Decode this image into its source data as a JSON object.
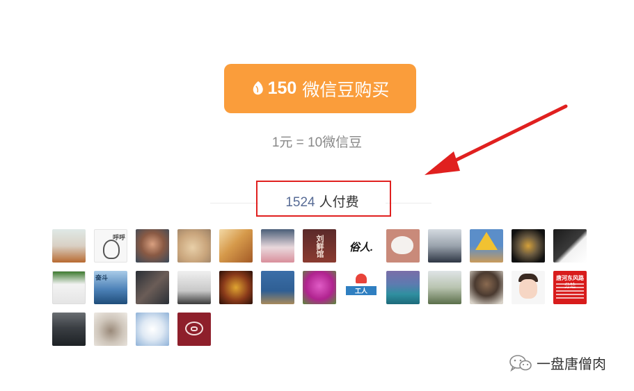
{
  "buy_button": {
    "amount": "150",
    "label": "微信豆购买"
  },
  "rate_text": "1元 = 10微信豆",
  "paid": {
    "count": "1524",
    "label": "人付费"
  },
  "avatar_texts": {
    "a2": "呼呼",
    "a7": "刘鲜馆",
    "a8": "俗人.",
    "a15": "奋斗",
    "a20": "工人",
    "a26": "唐河东风路分站"
  },
  "watermark": {
    "name": "一盘唐僧肉"
  },
  "colors": {
    "accent": "#fa9d3b",
    "link": "#576b95",
    "highlight": "#e0201f"
  }
}
